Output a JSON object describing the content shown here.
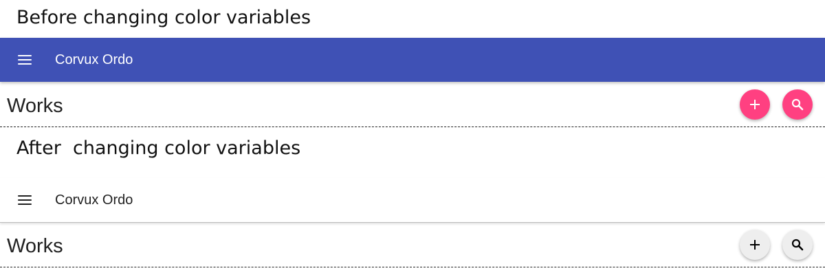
{
  "before": {
    "caption": "Before changing color variables",
    "toolbar": {
      "app_title": "Corvux Ordo",
      "menu_icon": "menu-icon",
      "background": "#3f51b5",
      "text_color": "#ffffff"
    },
    "section": {
      "heading": "Works",
      "add_icon": "add-icon",
      "search_icon": "search-icon",
      "fab_color": "#ff4081",
      "fab_icon_color": "#ffffff"
    }
  },
  "after": {
    "caption": "After  changing color variables",
    "toolbar": {
      "app_title": "Corvux Ordo",
      "menu_icon": "menu-icon",
      "background": "#ffffff",
      "text_color": "#212121"
    },
    "section": {
      "heading": "Works",
      "add_icon": "add-icon",
      "search_icon": "search-icon",
      "fab_color": "#eeeeee",
      "fab_icon_color": "#000000"
    }
  }
}
